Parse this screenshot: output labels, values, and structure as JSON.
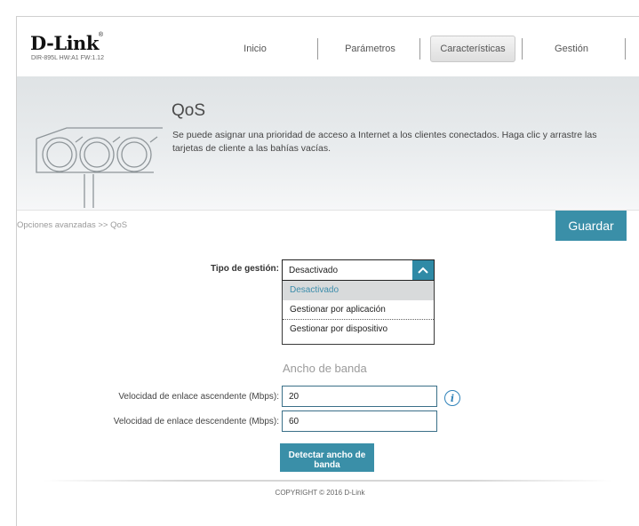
{
  "brand": {
    "logo": "D-Link",
    "model_info": "DIR-895L   HW:A1    FW:1.12"
  },
  "nav": {
    "items": [
      {
        "label": "Inicio"
      },
      {
        "label": "Parámetros"
      },
      {
        "label": "Características",
        "active": true
      },
      {
        "label": "Gestión"
      }
    ]
  },
  "banner": {
    "title": "QoS",
    "description": "Se puede asignar una prioridad de acceso a Internet a los clientes conectados. Haga clic y arrastre las tarjetas de cliente a las bahías vacías."
  },
  "breadcrumb": "Opciones avanzadas >> QoS",
  "save_label": "Guardar",
  "form": {
    "management_type": {
      "label": "Tipo de gestión:",
      "value": "Desactivado",
      "options": [
        "Desactivado",
        "Gestionar por aplicación",
        "Gestionar por dispositivo"
      ],
      "selected_index": 0
    },
    "bandwidth_section": "Ancho de banda",
    "upload": {
      "label": "Velocidad de enlace ascendente (Mbps):",
      "value": "20"
    },
    "download": {
      "label": "Velocidad de enlace descendente (Mbps):",
      "value": "60"
    },
    "detect_button": "Detectar ancho de banda"
  },
  "footer": {
    "copyright": "COPYRIGHT © 2016 D-Link"
  },
  "colors": {
    "accent": "#3a8fa8",
    "info": "#2f82b9"
  }
}
